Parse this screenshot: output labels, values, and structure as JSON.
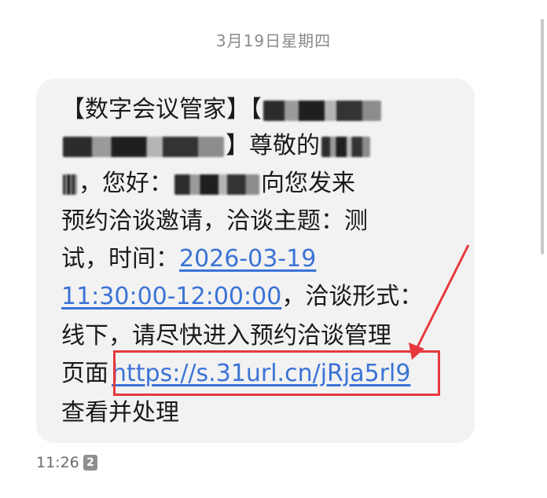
{
  "date_header": "3月19日星期四",
  "message": {
    "line1_prefix": "【数字会议管家】【",
    "line2_suffix": "】尊敬的",
    "line3_middle": "，您好：",
    "line3_suffix": "向您发来",
    "line4": "预约洽谈邀请，洽谈主题：测",
    "line5_prefix": "试，时间：",
    "line5_link": "2026-03-19",
    "line6_link": "11:30:00-12:00:00",
    "line6_suffix": "，洽谈形式：",
    "line7": "线下，请尽快进入预约洽谈管理",
    "line8_prefix": "页面",
    "line8_link": "https://s.31url.cn/jRja5rl9",
    "line9": "查看并处理"
  },
  "meta": {
    "time": "11:26",
    "sim_badge": "2"
  },
  "colors": {
    "link": "#3b73d6",
    "annotation_red": "#e8383d",
    "bubble_bg": "#f2f2f2"
  }
}
